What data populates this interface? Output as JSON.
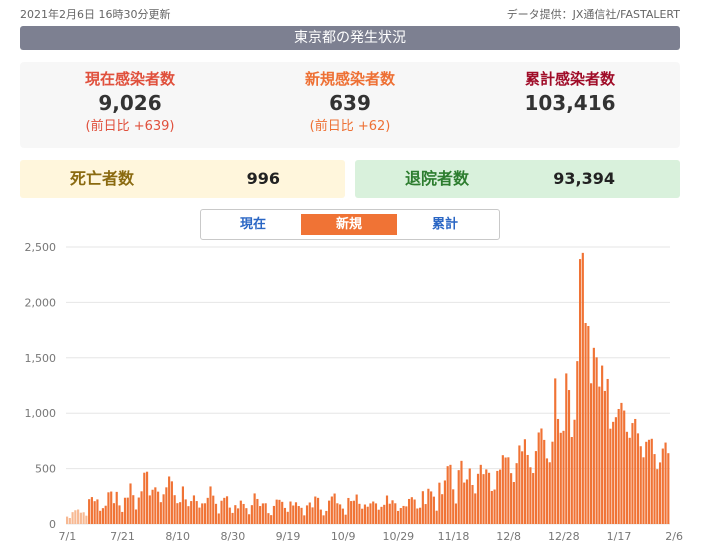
{
  "header": {
    "updated": "2021年2月6日 16時30分更新",
    "source": "データ提供：JX通信社/FASTALERT",
    "title": "東京都の発生状況"
  },
  "stats": {
    "current": {
      "label": "現在感染者数",
      "value": "9,026",
      "diff": "(前日比 +639)"
    },
    "new": {
      "label": "新規感染者数",
      "value": "639",
      "diff": "(前日比 +62)"
    },
    "total": {
      "label": "累計感染者数",
      "value": "103,416"
    }
  },
  "deaths": {
    "label": "死亡者数",
    "value": "996"
  },
  "recovered": {
    "label": "退院者数",
    "value": "93,394"
  },
  "tabs": [
    {
      "label": "現在",
      "active": false
    },
    {
      "label": "新規",
      "active": true
    },
    {
      "label": "累計",
      "active": false
    }
  ],
  "colors": {
    "bar": "#f07335",
    "bar_early": "#f7b993",
    "grid": "#e6e6e6",
    "tab_active": "#f07335"
  },
  "chart_data": {
    "type": "bar",
    "ylim": [
      0,
      2500
    ],
    "yticks": [
      "0",
      "500",
      "1,000",
      "1,500",
      "2,000",
      "2,500"
    ],
    "ytick_values": [
      0,
      500,
      1000,
      1500,
      2000,
      2500
    ],
    "x_ticks": [
      {
        "label": "7/1",
        "index": 0
      },
      {
        "label": "7/21",
        "index": 20
      },
      {
        "label": "8/10",
        "index": 40
      },
      {
        "label": "8/30",
        "index": 60
      },
      {
        "label": "9/19",
        "index": 80
      },
      {
        "label": "10/9",
        "index": 100
      },
      {
        "label": "10/29",
        "index": 120
      },
      {
        "label": "11/18",
        "index": 140
      },
      {
        "label": "12/8",
        "index": 160
      },
      {
        "label": "12/28",
        "index": 180
      },
      {
        "label": "1/17",
        "index": 200
      },
      {
        "label": "2/6",
        "index": 220
      }
    ],
    "series": [
      {
        "values": [
          67,
          54,
          107,
          124,
          131,
          102,
          106,
          75,
          224,
          243,
          206,
          222,
          119,
          143,
          165,
          286,
          293,
          188,
          290,
          168,
          109,
          237,
          238,
          366,
          260,
          131,
          239,
          295,
          463,
          472,
          258,
          309,
          331,
          292,
          197,
          268,
          331,
          429,
          385,
          260,
          188,
          197,
          339,
          222,
          161,
          207,
          258,
          207,
          148,
          186,
          187,
          236,
          339,
          256,
          182,
          95,
          210,
          236,
          250,
          148,
          100,
          170,
          141,
          211,
          181,
          143,
          88,
          170,
          276,
          226,
          162,
          186,
          187,
          98,
          80,
          163,
          220,
          218,
          200,
          145,
          110,
          203,
          167,
          196,
          162,
          146,
          78,
          168,
          194,
          150,
          248,
          236,
          130,
          78,
          118,
          211,
          248,
          275,
          187,
          177,
          139,
          84,
          235,
          207,
          210,
          266,
          182,
          138,
          176,
          156,
          186,
          203,
          186,
          129,
          155,
          173,
          257,
          183,
          214,
          187,
          118,
          144,
          163,
          159,
          226,
          242,
          221,
          140,
          147,
          296,
          180,
          318,
          294,
          247,
          120,
          373,
          269,
          393,
          522,
          534,
          313,
          185,
          486,
          570,
          374,
          402,
          501,
          352,
          276,
          453,
          534,
          450,
          493,
          462,
          298,
          311,
          479,
          491,
          621,
          600,
          602,
          459,
          379,
          549,
          709,
          656,
          765,
          623,
          512,
          460,
          658,
          826,
          862,
          759,
          592,
          557,
          743,
          1314,
          948,
          823,
          841,
          1359,
          1209,
          785,
          941,
          1470,
          2391,
          2447,
          1814,
          1787,
          1270,
          1590,
          1504,
          1240,
          1430,
          1201,
          1309,
          860,
          922,
          964,
          1038,
          1093,
          1024,
          832,
          778,
          911,
          948,
          818,
          702,
          602,
          742,
          760,
          769,
          631,
          495,
          556,
          681,
          735,
          639
        ]
      }
    ]
  }
}
